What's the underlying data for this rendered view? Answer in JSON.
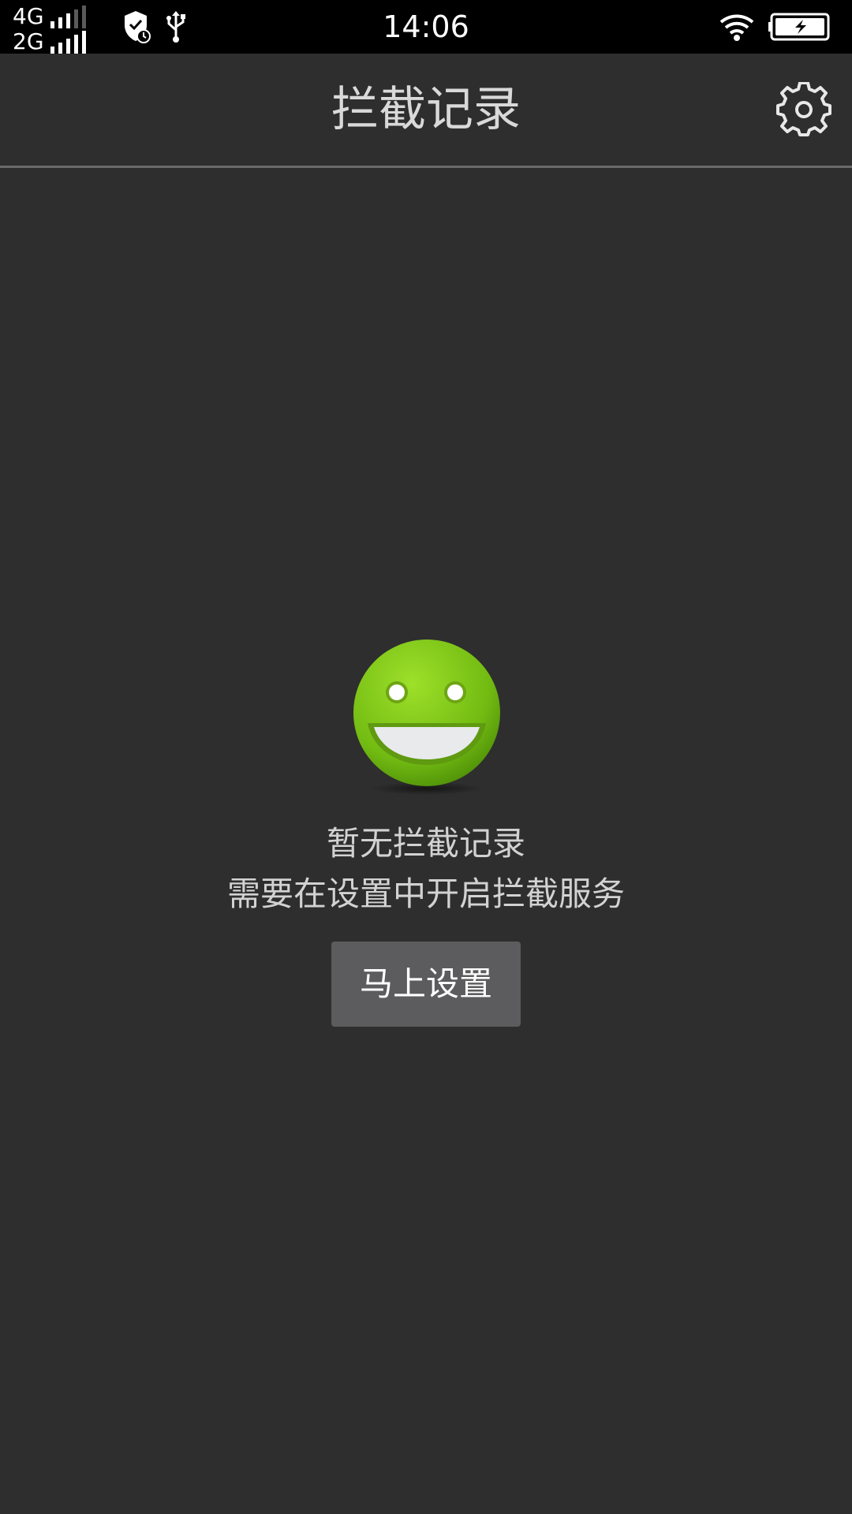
{
  "status_bar": {
    "network_top": "4G",
    "network_bottom": "2G",
    "time": "14:06",
    "icons": [
      "shield-icon",
      "usb-icon",
      "wifi-icon",
      "battery-charging-icon"
    ]
  },
  "app_bar": {
    "title": "拦截记录",
    "settings_icon": "gear-icon"
  },
  "empty_state": {
    "icon": "smiley-face-icon",
    "title": "暂无拦截记录",
    "subtitle": "需要在设置中开启拦截服务",
    "button_label": "马上设置"
  },
  "colors": {
    "background": "#2e2e2e",
    "status_bar": "#000000",
    "divider": "#6a6a6a",
    "button": "#5c5c5e",
    "smiley_green": "#7cc31e"
  }
}
